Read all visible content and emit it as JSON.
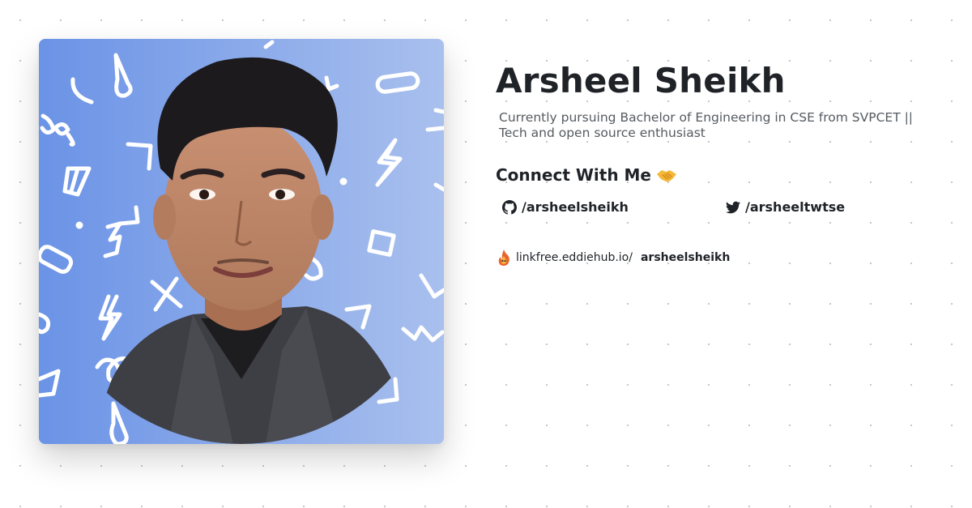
{
  "profile": {
    "name": "Arsheel Sheikh",
    "bio": "Currently pursuing Bachelor of Engineering in CSE from SVPCET || Tech and open source enthusiast",
    "photo_alt": "profile-photo"
  },
  "connect": {
    "heading": "Connect With Me",
    "icon": "handshake-icon"
  },
  "socials": [
    {
      "platform": "github",
      "icon": "github-icon",
      "label": "/arsheelsheikh"
    },
    {
      "platform": "twitter",
      "icon": "twitter-icon",
      "label": "/arsheeltwtse"
    }
  ],
  "footer": {
    "icon": "linkfree-flame-icon",
    "domain": "linkfree.eddiehub.io/",
    "username": "arsheelsheikh"
  },
  "colors": {
    "photo_gradient_start": "#6b93e6",
    "photo_gradient_end": "#a7bfee",
    "text_primary": "#1f2328",
    "text_secondary": "#555b61",
    "doodle": "#ffffff"
  }
}
